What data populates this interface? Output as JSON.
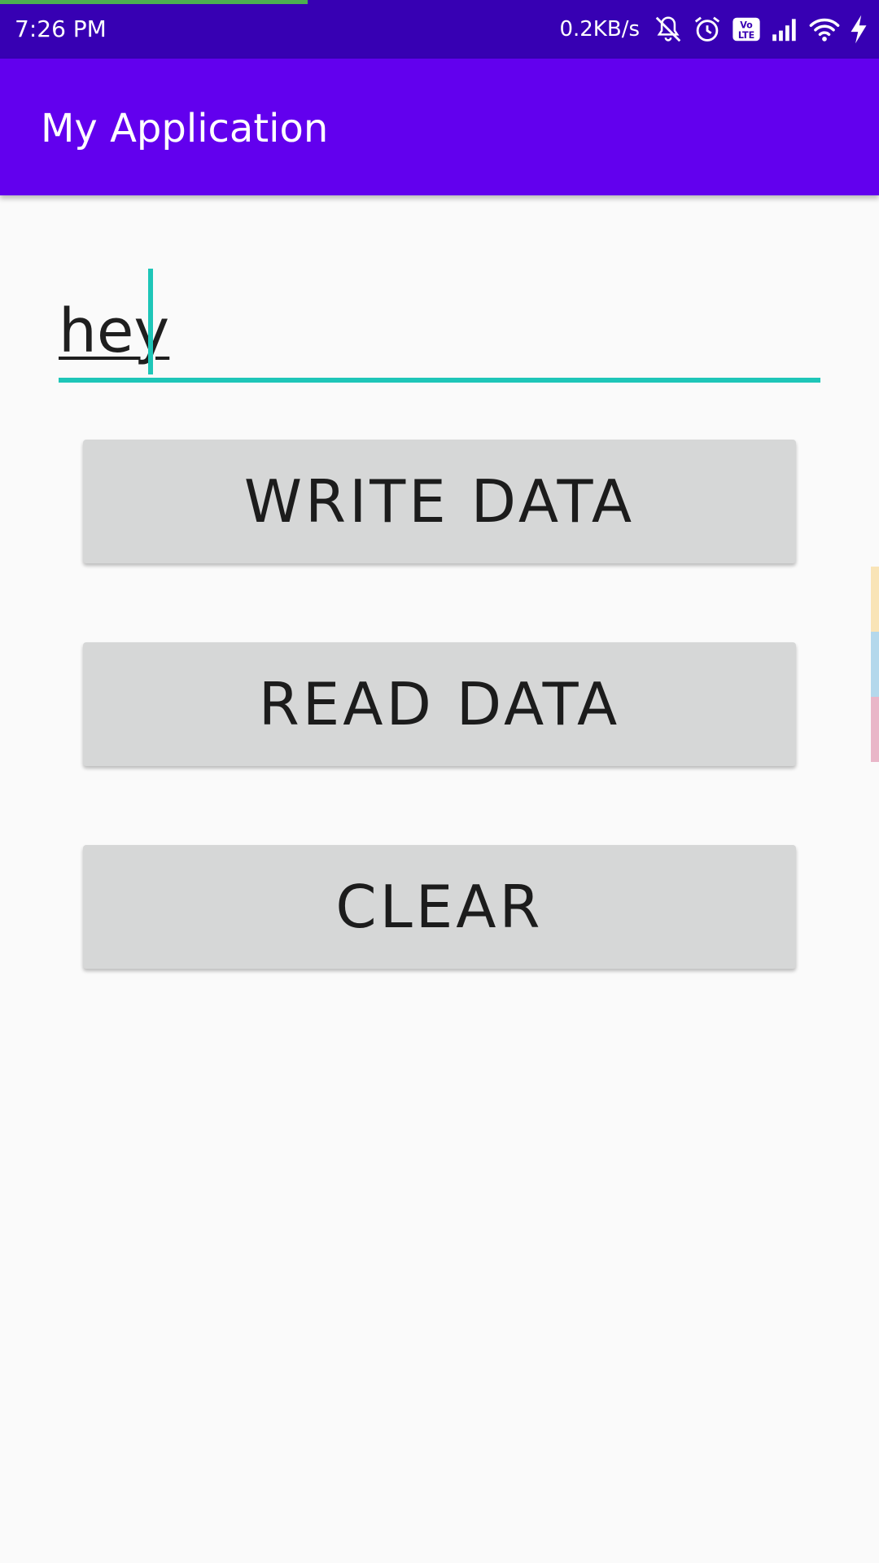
{
  "status_bar": {
    "time": "7:26 PM",
    "net_speed": "0.2KB/s",
    "icons": [
      "bell-muted-icon",
      "alarm-icon",
      "volte-icon",
      "signal-icon",
      "wifi-icon",
      "charging-icon"
    ],
    "volte_label_top": "Vo",
    "volte_label_bottom": "LTE",
    "progress_fraction": 0.35,
    "progress_color": "#4caf50"
  },
  "app_bar": {
    "title": "My Application",
    "color": "#6200ee"
  },
  "edit_text": {
    "value": "hey",
    "accent_color": "#1ec6b8"
  },
  "buttons": {
    "write_label": "WRITE DATA",
    "read_label": "READ DATA",
    "clear_label": "CLEAR"
  },
  "edge_tabs": {
    "colors": [
      "#f9e4b7",
      "#b4d8ec",
      "#e9b6c8"
    ]
  }
}
